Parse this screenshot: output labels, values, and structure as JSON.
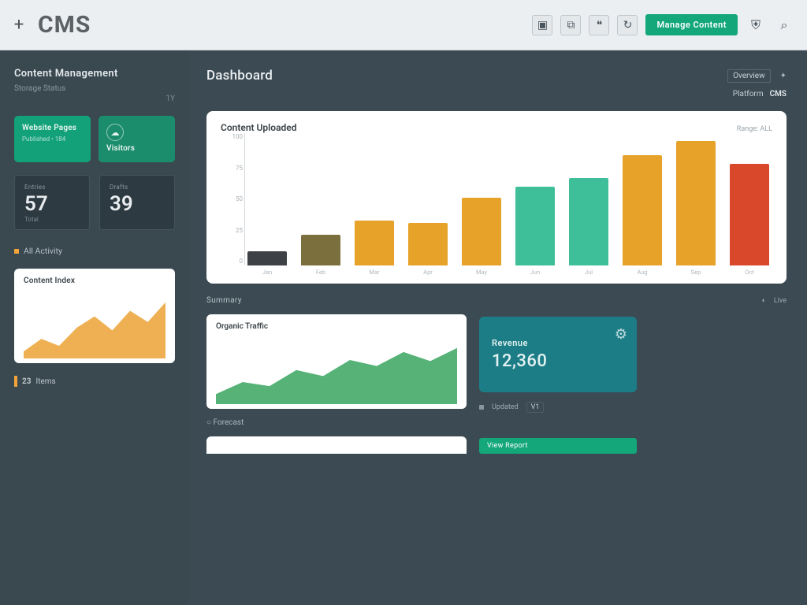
{
  "topbar": {
    "logo": "CMS",
    "primary_button": "Manage Content",
    "tooltray": [
      "image-icon",
      "duplicate-icon",
      "speech-icon",
      "refresh-icon"
    ],
    "right_icons": [
      "shield-icon",
      "search-icon"
    ]
  },
  "sidebar": {
    "heading": "Content Management",
    "subheading": "Storage Status",
    "aux": "1Y",
    "tiles": [
      {
        "label": "Website Pages",
        "sub": "Published • 184"
      },
      {
        "label": "Visitors",
        "icon": "cloud-icon"
      }
    ],
    "stats": [
      {
        "label": "Entries",
        "value": "57",
        "sub": "Total"
      },
      {
        "label": "Drafts",
        "value": "39",
        "sub": ""
      }
    ],
    "section_label": "All Activity",
    "mini_card_title": "Content Index",
    "footer": {
      "value": "23",
      "label": "Items"
    }
  },
  "content": {
    "title": "Dashboard",
    "breadcrumb_label": "Overview",
    "brand_tag": "CMS",
    "brand_sub": "Platform",
    "bar_card": {
      "title": "Content Uploaded",
      "sub": "Range: ALL"
    },
    "section2_label": "Summary",
    "area_card_title": "Organic Traffic",
    "stat_card": {
      "label": "Revenue",
      "value": "12,360"
    },
    "meta1": "Updated",
    "meta2": "Live",
    "pill": "V1",
    "foot_label": "○ Forecast",
    "tiny_button": "View Report"
  },
  "chart_data": [
    {
      "type": "bar",
      "title": "Content Uploaded",
      "categories": [
        "Jan",
        "Feb",
        "Mar",
        "Apr",
        "May",
        "Jun",
        "Jul",
        "Aug",
        "Sep",
        "Oct"
      ],
      "values": [
        10,
        22,
        32,
        30,
        48,
        56,
        62,
        78,
        88,
        72
      ],
      "colors": [
        "#3e4246",
        "#7c6f3e",
        "#e6a229",
        "#e6a229",
        "#e6a229",
        "#3fbf99",
        "#3fbf99",
        "#e6a229",
        "#e6a229",
        "#d9482b"
      ],
      "ylim": [
        0,
        100
      ],
      "yticks": [
        "100",
        "75",
        "50",
        "25",
        "0"
      ],
      "xlabel": "",
      "ylabel": ""
    },
    {
      "type": "area",
      "title": "Content Index",
      "x": [
        0,
        1,
        2,
        3,
        4,
        5,
        6,
        7,
        8
      ],
      "series": [
        {
          "name": "index",
          "values": [
            5,
            14,
            9,
            22,
            30,
            20,
            34,
            26,
            40
          ]
        }
      ],
      "color": "#eba234",
      "ylim": [
        0,
        50
      ]
    },
    {
      "type": "area",
      "title": "Organic Traffic",
      "x": [
        0,
        1,
        2,
        3,
        4,
        5,
        6,
        7,
        8,
        9
      ],
      "series": [
        {
          "name": "traffic",
          "values": [
            10,
            22,
            18,
            34,
            28,
            44,
            38,
            52,
            43,
            56
          ]
        }
      ],
      "color": "#38a55f",
      "ylim": [
        0,
        70
      ]
    }
  ]
}
